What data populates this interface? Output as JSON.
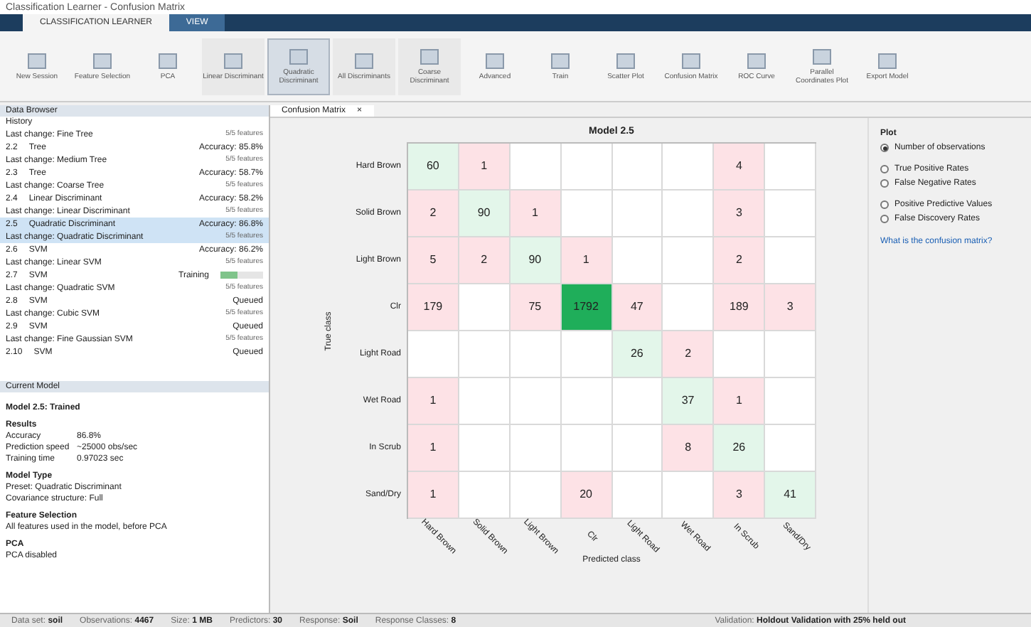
{
  "window": {
    "title": "Classification Learner - Confusion Matrix"
  },
  "tabs": [
    {
      "label": "CLASSIFICATION LEARNER",
      "selected": true
    },
    {
      "label": "VIEW",
      "selected": false
    }
  ],
  "toolstrip": [
    {
      "label": "New Session"
    },
    {
      "label": "Feature Selection"
    },
    {
      "label": "PCA"
    },
    {
      "label": "Linear Discriminant",
      "selected": false
    },
    {
      "label": "Quadratic Discriminant",
      "selected": true
    },
    {
      "label": "All Discriminants",
      "selected": false
    },
    {
      "label": "Coarse Discriminant",
      "selected": false
    },
    {
      "label": "Advanced"
    },
    {
      "label": "Train"
    },
    {
      "label": "Scatter Plot"
    },
    {
      "label": "Confusion Matrix"
    },
    {
      "label": "ROC Curve"
    },
    {
      "label": "Parallel Coordinates Plot"
    },
    {
      "label": "Export Model"
    }
  ],
  "data_browser": {
    "title": "Data Browser",
    "history_title": "History",
    "items": [
      {
        "change": "Last change: Fine Tree",
        "features": "5/5 features",
        "selected": false,
        "kind": "partial"
      },
      {
        "id": "2.2",
        "name": "Tree",
        "status": "Accuracy: 85.8%",
        "change": "Last change: Medium Tree",
        "features": "5/5 features",
        "selected": false,
        "kind": "done"
      },
      {
        "id": "2.3",
        "name": "Tree",
        "status": "Accuracy: 58.7%",
        "change": "Last change: Coarse Tree",
        "features": "5/5 features",
        "selected": false,
        "kind": "done"
      },
      {
        "id": "2.4",
        "name": "Linear Discriminant",
        "status": "Accuracy: 58.2%",
        "change": "Last change: Linear Discriminant",
        "features": "5/5 features",
        "selected": false,
        "kind": "done"
      },
      {
        "id": "2.5",
        "name": "Quadratic Discriminant",
        "status": "Accuracy: 86.8%",
        "change": "Last change: Quadratic Discriminant",
        "features": "5/5 features",
        "selected": true,
        "kind": "done"
      },
      {
        "id": "2.6",
        "name": "SVM",
        "status": "Accuracy: 86.2%",
        "change": "Last change: Linear SVM",
        "features": "5/5 features",
        "selected": false,
        "kind": "done"
      },
      {
        "id": "2.7",
        "name": "SVM",
        "status": "Training",
        "level": 0.4,
        "change": "Last change: Quadratic SVM",
        "features": "5/5 features",
        "selected": false,
        "kind": "training"
      },
      {
        "id": "2.8",
        "name": "SVM",
        "status": "Queued",
        "change": "Last change: Cubic SVM",
        "features": "5/5 features",
        "selected": false,
        "kind": "queued"
      },
      {
        "id": "2.9",
        "name": "SVM",
        "status": "Queued",
        "change": "Last change: Fine Gaussian SVM",
        "features": "5/5 features",
        "selected": false,
        "kind": "queued"
      },
      {
        "id": "2.10",
        "name": "SVM",
        "status": "Queued",
        "selected": false,
        "kind": "queued"
      }
    ]
  },
  "current_model": {
    "title": "Current Model",
    "heading": "Model 2.5: Trained",
    "sections": [
      {
        "title": "Results",
        "rows": [
          [
            "Accuracy",
            "86.8%"
          ],
          [
            "Prediction speed",
            "~25000 obs/sec"
          ],
          [
            "Training time",
            "0.97023 sec"
          ]
        ]
      },
      {
        "title": "Model Type",
        "rows": [
          [
            "Preset: Quadratic Discriminant"
          ],
          [
            "Covariance structure: Full"
          ]
        ]
      },
      {
        "title": "Feature Selection",
        "rows": [
          [
            "All features used in the model, before PCA"
          ]
        ]
      },
      {
        "title": "PCA",
        "rows": [
          [
            "PCA disabled"
          ]
        ]
      }
    ]
  },
  "document_tab": {
    "label": "Confusion Matrix",
    "close": "×"
  },
  "matrix": {
    "title": "Model 2.5",
    "ylabel": "True class",
    "xlabel": "Predicted class",
    "row_classes": [
      "Hard Brown",
      "Solid Brown",
      "Light Brown",
      "Clr",
      "Light Road",
      "Wet Road",
      "In Scrub",
      "Sand/Dry"
    ],
    "column_classes": [
      "Hard Brown",
      "Solid Brown",
      "Light Brown",
      "Clr",
      "Light Road",
      "Wet Road",
      "In Scrub",
      "Sand/Dry"
    ],
    "cells": [
      [
        "60",
        "1",
        null,
        null,
        null,
        null,
        "4",
        null
      ],
      [
        "2",
        "90",
        "1",
        null,
        null,
        null,
        "3",
        null
      ],
      [
        "5",
        "2",
        "90",
        "1",
        null,
        null,
        "2",
        null
      ],
      [
        "179",
        null,
        "75",
        "1792",
        "47",
        null,
        "189",
        "3"
      ],
      [
        null,
        null,
        null,
        null,
        "26",
        "2",
        null,
        null
      ],
      [
        "1",
        null,
        null,
        null,
        null,
        "37",
        "1",
        null
      ],
      [
        "1",
        null,
        null,
        null,
        null,
        "8",
        "26",
        null
      ],
      [
        "1",
        null,
        null,
        "20",
        null,
        null,
        "3",
        "41"
      ]
    ]
  },
  "plot_panel": {
    "title": "Plot",
    "options": [
      {
        "label": "Number of observations",
        "selected": true,
        "kind": "single"
      },
      {
        "label": "True Positive Rates",
        "selected": false,
        "kind": "pair_top"
      },
      {
        "label": "False Negative Rates",
        "selected": false,
        "kind": "pair_bottom"
      },
      {
        "label": "Positive Predictive Values",
        "selected": false,
        "kind": "pair_top"
      },
      {
        "label": "False Discovery Rates",
        "selected": false,
        "kind": "pair_bottom"
      }
    ],
    "link": "What is the confusion matrix?"
  },
  "status_bar": [
    {
      "label": "Data set:",
      "value": "soil"
    },
    {
      "label": "Observations:",
      "value": "4467"
    },
    {
      "label": "Size:",
      "value": "1 MB"
    },
    {
      "label": "Predictors:",
      "value": "30"
    },
    {
      "label": "Response:",
      "value": "Soil"
    },
    {
      "label": "Response Classes:",
      "value": "8"
    }
  ],
  "validation": {
    "label": "Validation:",
    "value": "Holdout Validation with 25% held out"
  }
}
